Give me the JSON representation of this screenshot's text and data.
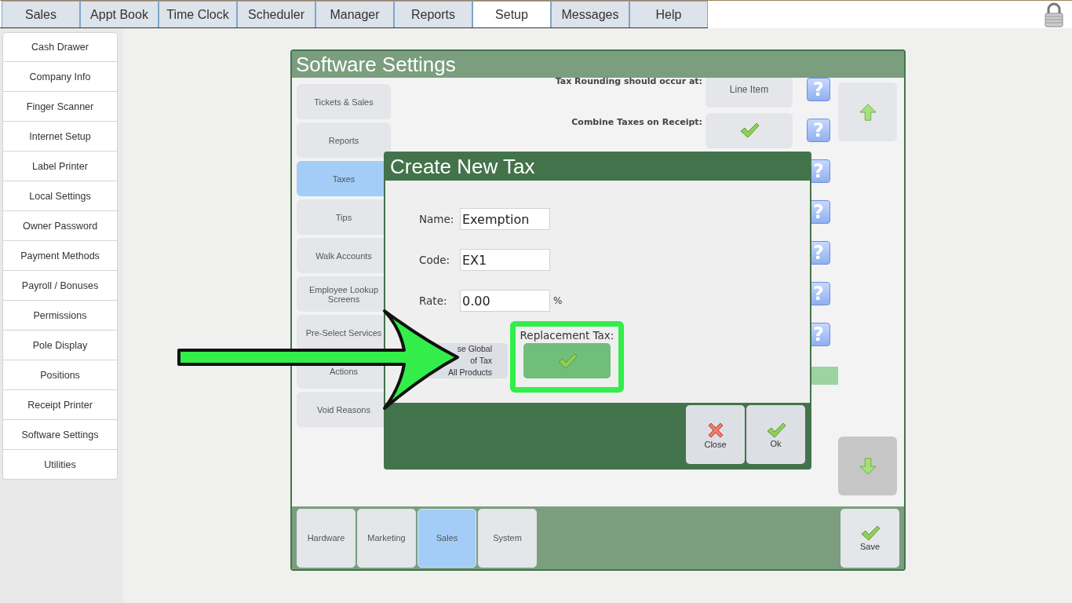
{
  "top_tabs": [
    {
      "label": "Sales",
      "selected": false
    },
    {
      "label": "Appt Book",
      "selected": false
    },
    {
      "label": "Time Clock",
      "selected": false
    },
    {
      "label": "Scheduler",
      "selected": false
    },
    {
      "label": "Manager",
      "selected": false
    },
    {
      "label": "Reports",
      "selected": false
    },
    {
      "label": "Setup",
      "selected": true
    },
    {
      "label": "Messages",
      "selected": false
    },
    {
      "label": "Help",
      "selected": false
    }
  ],
  "sidebar": {
    "items": [
      "Cash Drawer",
      "Company Info",
      "Finger Scanner",
      "Internet Setup",
      "Label Printer",
      "Local Settings",
      "Owner Password",
      "Payment Methods",
      "Payroll / Bonuses",
      "Permissions",
      "Pole Display",
      "Positions",
      "Receipt Printer",
      "Software Settings",
      "Utilities"
    ]
  },
  "panel": {
    "title": "Software Settings",
    "categories": [
      {
        "label": "Tickets & Sales",
        "selected": false
      },
      {
        "label": "Reports",
        "selected": false
      },
      {
        "label": "Taxes",
        "selected": true
      },
      {
        "label": "Tips",
        "selected": false
      },
      {
        "label": "Walk Accounts",
        "selected": false
      },
      {
        "label": "Employee Lookup Screens",
        "selected": false
      },
      {
        "label": "Pre-Select Services",
        "selected": false
      },
      {
        "label": "Actions",
        "selected": false
      },
      {
        "label": "Void Reasons",
        "selected": false
      }
    ],
    "settings": [
      {
        "kind": "text",
        "label": "Tax Rounding should occur at:",
        "value": "Line Item",
        "help": "?"
      },
      {
        "kind": "check",
        "label": "Combine Taxes on Receipt:",
        "checked": true,
        "help": "?"
      },
      {
        "kind": "covered",
        "help": "?"
      },
      {
        "kind": "covered",
        "help": "?"
      },
      {
        "kind": "covered",
        "help": "?"
      },
      {
        "kind": "covered",
        "help": "?"
      },
      {
        "kind": "covered",
        "help": "?"
      },
      {
        "kind": "bar"
      }
    ],
    "scroll_up": {
      "disabled": false
    },
    "scroll_down": {
      "disabled": true
    },
    "bottom_tabs": [
      {
        "label": "Hardware",
        "selected": false
      },
      {
        "label": "Marketing",
        "selected": false
      },
      {
        "label": "Sales",
        "selected": true
      },
      {
        "label": "System",
        "selected": false
      }
    ],
    "save": "Save"
  },
  "dialog": {
    "title": "Create New Tax",
    "fields": [
      {
        "label": "Name:",
        "value": "Exemption"
      },
      {
        "label": "Code:",
        "value": "EX1"
      },
      {
        "label": "Rate:",
        "value": "0.00",
        "unit": "%"
      }
    ],
    "global_button": [
      "se Global",
      "of Tax",
      "All Products"
    ],
    "replacement_tax": {
      "label": "Replacement Tax:",
      "checked": true,
      "highlighted": true
    },
    "buttons": [
      {
        "kind": "close",
        "label": "Close"
      },
      {
        "kind": "ok",
        "label": "Ok"
      }
    ]
  }
}
